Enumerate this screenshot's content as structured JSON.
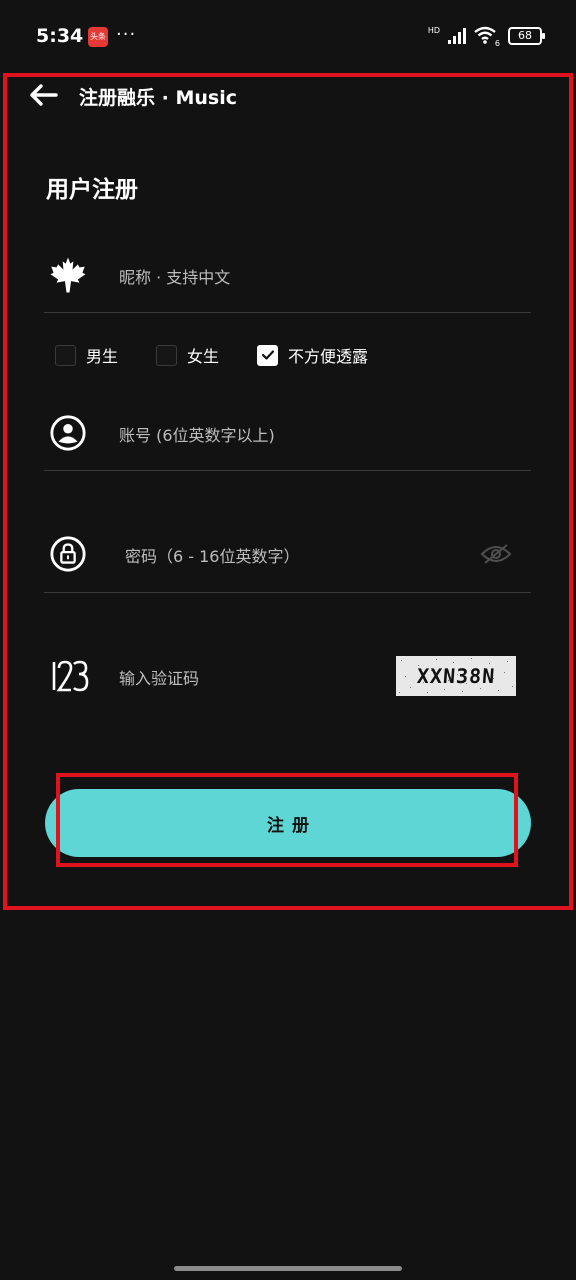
{
  "status_bar": {
    "time": "5:34",
    "app_icon_text": "头条",
    "more": "···",
    "hd": "HD",
    "network": "6",
    "battery": "68"
  },
  "header": {
    "title": "注册融乐 · Music",
    "back_icon": "arrow-left-icon"
  },
  "page": {
    "title": "用户注册"
  },
  "form": {
    "nickname": {
      "placeholder": "昵称 · 支持中文",
      "icon": "maple-leaf-icon"
    },
    "gender": {
      "options": [
        {
          "label": "男生",
          "checked": false
        },
        {
          "label": "女生",
          "checked": false
        },
        {
          "label": "不方便透露",
          "checked": true
        }
      ]
    },
    "account": {
      "placeholder": "账号 (6位英数字以上)",
      "icon": "user-circle-icon"
    },
    "password": {
      "placeholder": "密码（6 - 16位英数字）",
      "icon": "lock-icon",
      "toggle_icon": "eye-off-icon"
    },
    "captcha": {
      "placeholder": "输入验证码",
      "icon": "number-123-icon",
      "code": "XXN38N"
    },
    "submit_label": "注册"
  },
  "colors": {
    "background": "#121212",
    "accent": "#5fd6d6",
    "annotation_red": "#e0121d"
  }
}
